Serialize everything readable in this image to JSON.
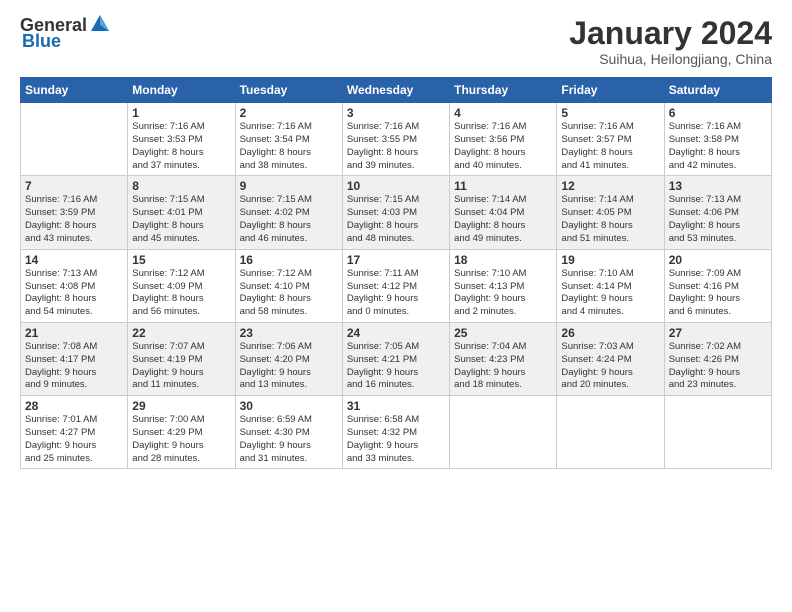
{
  "header": {
    "logo_general": "General",
    "logo_blue": "Blue",
    "month_title": "January 2024",
    "subtitle": "Suihua, Heilongjiang, China"
  },
  "weekdays": [
    "Sunday",
    "Monday",
    "Tuesday",
    "Wednesday",
    "Thursday",
    "Friday",
    "Saturday"
  ],
  "weeks": [
    [
      {
        "day": "",
        "info": ""
      },
      {
        "day": "1",
        "info": "Sunrise: 7:16 AM\nSunset: 3:53 PM\nDaylight: 8 hours\nand 37 minutes."
      },
      {
        "day": "2",
        "info": "Sunrise: 7:16 AM\nSunset: 3:54 PM\nDaylight: 8 hours\nand 38 minutes."
      },
      {
        "day": "3",
        "info": "Sunrise: 7:16 AM\nSunset: 3:55 PM\nDaylight: 8 hours\nand 39 minutes."
      },
      {
        "day": "4",
        "info": "Sunrise: 7:16 AM\nSunset: 3:56 PM\nDaylight: 8 hours\nand 40 minutes."
      },
      {
        "day": "5",
        "info": "Sunrise: 7:16 AM\nSunset: 3:57 PM\nDaylight: 8 hours\nand 41 minutes."
      },
      {
        "day": "6",
        "info": "Sunrise: 7:16 AM\nSunset: 3:58 PM\nDaylight: 8 hours\nand 42 minutes."
      }
    ],
    [
      {
        "day": "7",
        "info": "Sunrise: 7:16 AM\nSunset: 3:59 PM\nDaylight: 8 hours\nand 43 minutes."
      },
      {
        "day": "8",
        "info": "Sunrise: 7:15 AM\nSunset: 4:01 PM\nDaylight: 8 hours\nand 45 minutes."
      },
      {
        "day": "9",
        "info": "Sunrise: 7:15 AM\nSunset: 4:02 PM\nDaylight: 8 hours\nand 46 minutes."
      },
      {
        "day": "10",
        "info": "Sunrise: 7:15 AM\nSunset: 4:03 PM\nDaylight: 8 hours\nand 48 minutes."
      },
      {
        "day": "11",
        "info": "Sunrise: 7:14 AM\nSunset: 4:04 PM\nDaylight: 8 hours\nand 49 minutes."
      },
      {
        "day": "12",
        "info": "Sunrise: 7:14 AM\nSunset: 4:05 PM\nDaylight: 8 hours\nand 51 minutes."
      },
      {
        "day": "13",
        "info": "Sunrise: 7:13 AM\nSunset: 4:06 PM\nDaylight: 8 hours\nand 53 minutes."
      }
    ],
    [
      {
        "day": "14",
        "info": "Sunrise: 7:13 AM\nSunset: 4:08 PM\nDaylight: 8 hours\nand 54 minutes."
      },
      {
        "day": "15",
        "info": "Sunrise: 7:12 AM\nSunset: 4:09 PM\nDaylight: 8 hours\nand 56 minutes."
      },
      {
        "day": "16",
        "info": "Sunrise: 7:12 AM\nSunset: 4:10 PM\nDaylight: 8 hours\nand 58 minutes."
      },
      {
        "day": "17",
        "info": "Sunrise: 7:11 AM\nSunset: 4:12 PM\nDaylight: 9 hours\nand 0 minutes."
      },
      {
        "day": "18",
        "info": "Sunrise: 7:10 AM\nSunset: 4:13 PM\nDaylight: 9 hours\nand 2 minutes."
      },
      {
        "day": "19",
        "info": "Sunrise: 7:10 AM\nSunset: 4:14 PM\nDaylight: 9 hours\nand 4 minutes."
      },
      {
        "day": "20",
        "info": "Sunrise: 7:09 AM\nSunset: 4:16 PM\nDaylight: 9 hours\nand 6 minutes."
      }
    ],
    [
      {
        "day": "21",
        "info": "Sunrise: 7:08 AM\nSunset: 4:17 PM\nDaylight: 9 hours\nand 9 minutes."
      },
      {
        "day": "22",
        "info": "Sunrise: 7:07 AM\nSunset: 4:19 PM\nDaylight: 9 hours\nand 11 minutes."
      },
      {
        "day": "23",
        "info": "Sunrise: 7:06 AM\nSunset: 4:20 PM\nDaylight: 9 hours\nand 13 minutes."
      },
      {
        "day": "24",
        "info": "Sunrise: 7:05 AM\nSunset: 4:21 PM\nDaylight: 9 hours\nand 16 minutes."
      },
      {
        "day": "25",
        "info": "Sunrise: 7:04 AM\nSunset: 4:23 PM\nDaylight: 9 hours\nand 18 minutes."
      },
      {
        "day": "26",
        "info": "Sunrise: 7:03 AM\nSunset: 4:24 PM\nDaylight: 9 hours\nand 20 minutes."
      },
      {
        "day": "27",
        "info": "Sunrise: 7:02 AM\nSunset: 4:26 PM\nDaylight: 9 hours\nand 23 minutes."
      }
    ],
    [
      {
        "day": "28",
        "info": "Sunrise: 7:01 AM\nSunset: 4:27 PM\nDaylight: 9 hours\nand 25 minutes."
      },
      {
        "day": "29",
        "info": "Sunrise: 7:00 AM\nSunset: 4:29 PM\nDaylight: 9 hours\nand 28 minutes."
      },
      {
        "day": "30",
        "info": "Sunrise: 6:59 AM\nSunset: 4:30 PM\nDaylight: 9 hours\nand 31 minutes."
      },
      {
        "day": "31",
        "info": "Sunrise: 6:58 AM\nSunset: 4:32 PM\nDaylight: 9 hours\nand 33 minutes."
      },
      {
        "day": "",
        "info": ""
      },
      {
        "day": "",
        "info": ""
      },
      {
        "day": "",
        "info": ""
      }
    ]
  ]
}
